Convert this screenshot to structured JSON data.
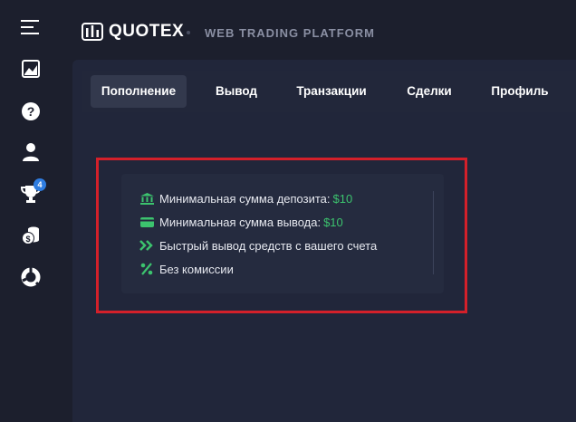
{
  "header": {
    "logo_text": "QUOTEX",
    "subtitle": "WEB TRADING PLATFORM"
  },
  "sidebar": {
    "items": [
      {
        "icon": "menu-icon"
      },
      {
        "icon": "chart-icon"
      },
      {
        "icon": "help-icon"
      },
      {
        "icon": "user-icon"
      },
      {
        "icon": "trophy-icon",
        "badge": "4"
      },
      {
        "icon": "coins-icon"
      },
      {
        "icon": "pie-icon"
      }
    ]
  },
  "tabs": [
    {
      "label": "Пополнение",
      "active": true
    },
    {
      "label": "Вывод",
      "active": false
    },
    {
      "label": "Транзакции",
      "active": false
    },
    {
      "label": "Сделки",
      "active": false
    },
    {
      "label": "Профиль",
      "active": false
    }
  ],
  "info": {
    "rows": [
      {
        "icon": "bank-icon",
        "text": "Минимальная сумма депозита:",
        "value": "$10"
      },
      {
        "icon": "card-icon",
        "text": "Минимальная сумма вывода:",
        "value": "$10"
      },
      {
        "icon": "double-chevron-icon",
        "text": "Быстрый вывод средств с вашего счета",
        "value": ""
      },
      {
        "icon": "percent-icon",
        "text": "Без комиссии",
        "value": ""
      }
    ]
  },
  "colors": {
    "background": "#1c1f2d",
    "accent_green": "#3cc36e",
    "highlight_red": "#d4202a",
    "badge_blue": "#2f7de1"
  }
}
